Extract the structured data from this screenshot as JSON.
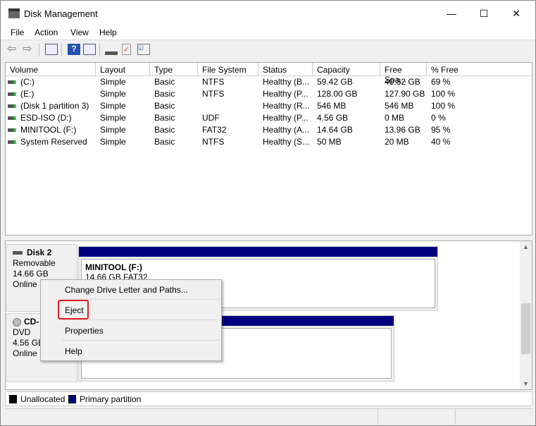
{
  "window": {
    "title": "Disk Management",
    "minimize": "—",
    "maximize": "☐",
    "close": "✕"
  },
  "menu": [
    "File",
    "Action",
    "View",
    "Help"
  ],
  "columns": [
    "Volume",
    "Layout",
    "Type",
    "File System",
    "Status",
    "Capacity",
    "Free Spa...",
    "% Free"
  ],
  "rows": [
    [
      "(C:)",
      "Simple",
      "Basic",
      "NTFS",
      "Healthy (B...",
      "59.42 GB",
      "40.82 GB",
      "69 %"
    ],
    [
      "(E:)",
      "Simple",
      "Basic",
      "NTFS",
      "Healthy (P...",
      "128.00 GB",
      "127.90 GB",
      "100 %"
    ],
    [
      "(Disk 1 partition 3)",
      "Simple",
      "Basic",
      "",
      "Healthy (R...",
      "546 MB",
      "546 MB",
      "100 %"
    ],
    [
      "ESD-ISO (D:)",
      "Simple",
      "Basic",
      "UDF",
      "Healthy (P...",
      "4.56 GB",
      "0 MB",
      "0 %"
    ],
    [
      "MINITOOL (F:)",
      "Simple",
      "Basic",
      "FAT32",
      "Healthy (A...",
      "14.64 GB",
      "13.96 GB",
      "95 %"
    ],
    [
      "System Reserved",
      "Simple",
      "Basic",
      "NTFS",
      "Healthy (S...",
      "50 MB",
      "20 MB",
      "40 %"
    ]
  ],
  "disks": [
    {
      "name": "Disk 2",
      "type": "Removable",
      "size": "14.66 GB",
      "state": "Online",
      "partition_name": "MINITOOL  (F:)",
      "partition_info": "14.66 GB FAT32"
    },
    {
      "name": "CD-",
      "type": "DVD",
      "size": "4.56 GB",
      "state": "Online"
    }
  ],
  "legend": [
    "Unallocated",
    "Primary partition"
  ],
  "colors": {
    "primary": "#000080",
    "unallocated": "#000000",
    "highlight": "#e51c23"
  },
  "context_menu": [
    "Change Drive Letter and Paths...",
    "Eject",
    "Properties",
    "Help"
  ]
}
